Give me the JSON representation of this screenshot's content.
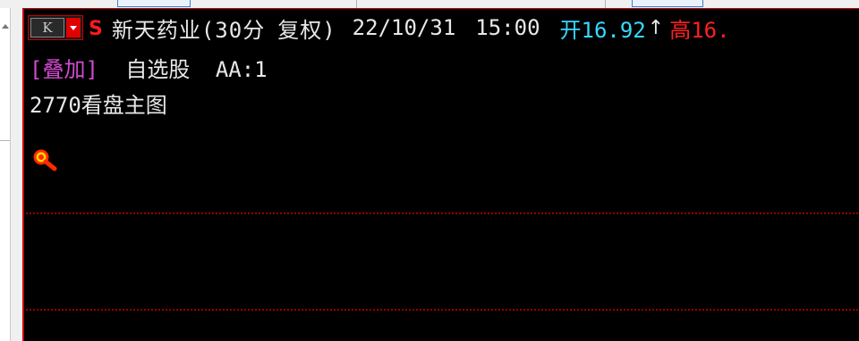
{
  "tabs": [
    {
      "label": ""
    },
    {
      "label": ""
    }
  ],
  "header": {
    "period_button": "K",
    "stock_name": "新天药业",
    "period": "(30分",
    "adjust": "复权)",
    "date": "22/10/31",
    "time": "15:00",
    "open_label": "开16.92",
    "open_direction": "↑",
    "high_label": "高16."
  },
  "overlay": {
    "link_label": "[叠加]",
    "watchlist_label": "自选股",
    "aa_label": "AA:1"
  },
  "main_chart": {
    "title": "2770看盘主图"
  },
  "icons": {
    "s": "S",
    "magnifier": "magnifier-icon",
    "dropdown": "chevron-down-icon"
  },
  "colors": {
    "background": "#000000",
    "border": "#c80000",
    "open": "#38d8ff",
    "high": "#ff2020",
    "overlay": "#d24ad2",
    "text": "#e8e8e8"
  }
}
